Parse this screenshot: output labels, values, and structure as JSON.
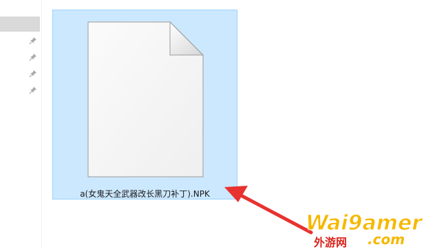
{
  "file": {
    "name": "a(女鬼天全武器改长黑刀补丁).NPK",
    "icon": "blank-document-icon"
  },
  "sidebar": {
    "pinned_count": 4,
    "pin_icon": "pin-icon"
  },
  "annotation": {
    "arrow_color": "#e8322f"
  },
  "watermark": {
    "logo_text": "Wai9amer",
    "subtitle": "外游网",
    "domain": ".com",
    "colors": {
      "gold": "#f5b800",
      "red": "#d9251d"
    }
  },
  "colors": {
    "selection_bg": "#cce8ff",
    "selection_border": "#99d1ff",
    "nav_selected": "#d9d9d9"
  }
}
